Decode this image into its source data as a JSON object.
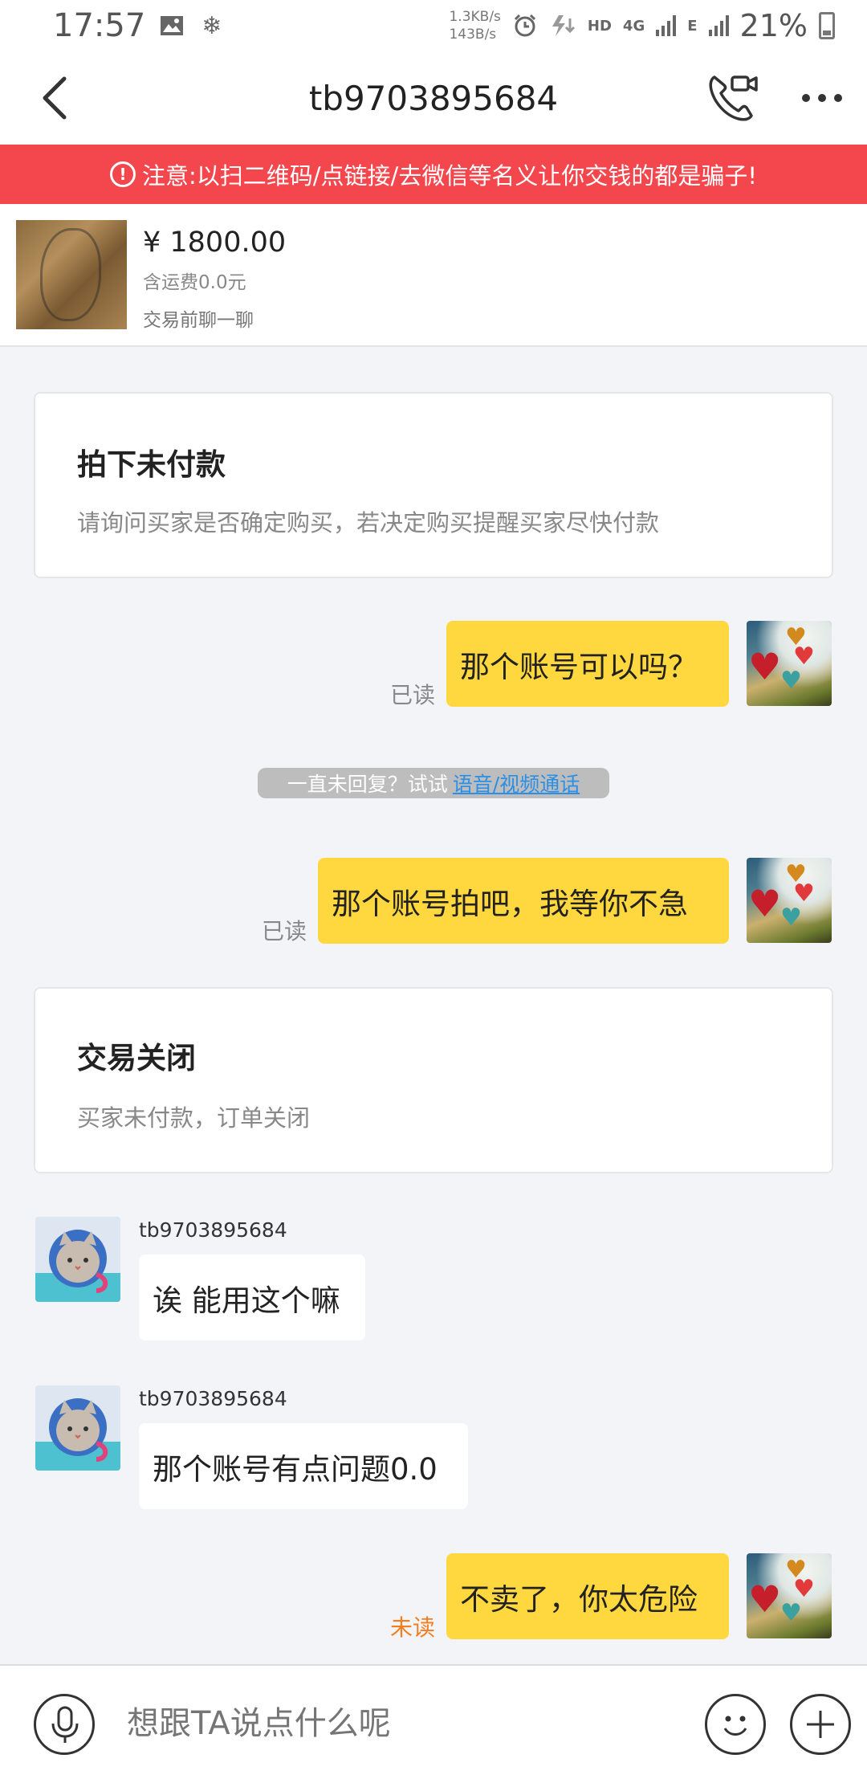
{
  "status_bar": {
    "time": "17:57",
    "net_up": "1.3KB/s",
    "net_down": "143B/s",
    "hd": "HD",
    "network_4g": "4G",
    "network_e": "E",
    "battery": "21%"
  },
  "header": {
    "title": "tb9703895684"
  },
  "warning": {
    "text": "注意:以扫二维码/点链接/去微信等名义让你交钱的都是骗子!"
  },
  "product": {
    "price": "¥ 1800.00",
    "shipping": "含运费0.0元",
    "chat_before": "交易前聊一聊"
  },
  "cards": {
    "unpaid": {
      "title": "拍下未付款",
      "desc": "请询问买家是否确定购买，若决定购买提醒买家尽快付款"
    },
    "closed": {
      "title": "交易关闭",
      "desc": "买家未付款，订单关闭"
    }
  },
  "messages": {
    "m1": {
      "text": "那个账号可以吗？",
      "status": "已读"
    },
    "tip": {
      "text": "一直未回复？试试",
      "link": "语音/视频通话"
    },
    "m2": {
      "text": "那个账号拍吧，我等你不急",
      "status": "已读"
    },
    "m3": {
      "sender": "tb9703895684",
      "text": "诶 能用这个嘛"
    },
    "m4": {
      "sender": "tb9703895684",
      "text": "那个账号有点问题0.0"
    },
    "m5": {
      "text": "不卖了，你太危险",
      "status": "未读"
    }
  },
  "input": {
    "placeholder": "想跟TA说点什么呢"
  },
  "colors": {
    "warning_bg": "#f4464d",
    "my_bubble": "#ffd83f",
    "unread": "#f47e1e",
    "link": "#2c8fe6"
  }
}
